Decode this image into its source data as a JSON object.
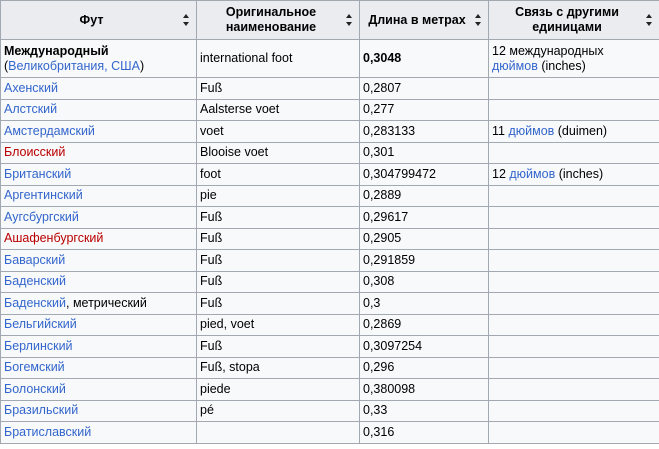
{
  "columns": [
    {
      "label": "Фут"
    },
    {
      "label": "Оригинальное наименование"
    },
    {
      "label": "Длина в метрах"
    },
    {
      "label": "Связь с другими единицами"
    }
  ],
  "first_row": {
    "name": "Международный",
    "paren_open": "(",
    "country_link": "Великобритания, США",
    "paren_close": ")",
    "original": "international foot",
    "length": "0,3048",
    "relation_prefix": "12 международных",
    "relation_link": "дюймов",
    "relation_suffix": " (inches)"
  },
  "rows": [
    {
      "name": "Ахенский",
      "name_color": "blue",
      "extra": "",
      "original": "Fuß",
      "length": "0,2807",
      "rel_pre": "",
      "rel_link": "",
      "rel_suf": ""
    },
    {
      "name": "Алстский",
      "name_color": "blue",
      "extra": "",
      "original": "Aalsterse voet",
      "length": "0,277",
      "rel_pre": "",
      "rel_link": "",
      "rel_suf": ""
    },
    {
      "name": "Амстердамский",
      "name_color": "blue",
      "extra": "",
      "original": "voet",
      "length": "0,283133",
      "rel_pre": "11 ",
      "rel_link": "дюймов",
      "rel_suf": " (duimen)"
    },
    {
      "name": "Блоисский",
      "name_color": "red",
      "extra": "",
      "original": "Blooise voet",
      "length": "0,301",
      "rel_pre": "",
      "rel_link": "",
      "rel_suf": ""
    },
    {
      "name": "Британский",
      "name_color": "blue",
      "extra": "",
      "original": "foot",
      "length": "0,304799472",
      "rel_pre": "12 ",
      "rel_link": "дюймов",
      "rel_suf": " (inches)"
    },
    {
      "name": "Аргентинский",
      "name_color": "blue",
      "extra": "",
      "original": "pie",
      "length": "0,2889",
      "rel_pre": "",
      "rel_link": "",
      "rel_suf": ""
    },
    {
      "name": "Аугсбургский",
      "name_color": "blue",
      "extra": "",
      "original": "Fuß",
      "length": "0,29617",
      "rel_pre": "",
      "rel_link": "",
      "rel_suf": ""
    },
    {
      "name": "Ашафенбургский",
      "name_color": "red",
      "extra": "",
      "original": "Fuß",
      "length": "0,2905",
      "rel_pre": "",
      "rel_link": "",
      "rel_suf": ""
    },
    {
      "name": "Баварский",
      "name_color": "blue",
      "extra": "",
      "original": "Fuß",
      "length": "0,291859",
      "rel_pre": "",
      "rel_link": "",
      "rel_suf": ""
    },
    {
      "name": "Баденский",
      "name_color": "blue",
      "extra": "",
      "original": "Fuß",
      "length": "0,308",
      "rel_pre": "",
      "rel_link": "",
      "rel_suf": ""
    },
    {
      "name": "Баденский",
      "name_color": "blue",
      "extra": ", метрический",
      "original": "Fuß",
      "length": "0,3",
      "rel_pre": "",
      "rel_link": "",
      "rel_suf": ""
    },
    {
      "name": "Бельгийский",
      "name_color": "blue",
      "extra": "",
      "original": "pied, voet",
      "length": "0,2869",
      "rel_pre": "",
      "rel_link": "",
      "rel_suf": ""
    },
    {
      "name": "Берлинский",
      "name_color": "blue",
      "extra": "",
      "original": "Fuß",
      "length": "0,3097254",
      "rel_pre": "",
      "rel_link": "",
      "rel_suf": ""
    },
    {
      "name": "Богемский",
      "name_color": "blue",
      "extra": "",
      "original": "Fuß, stopa",
      "length": "0,296",
      "rel_pre": "",
      "rel_link": "",
      "rel_suf": ""
    },
    {
      "name": "Болонский",
      "name_color": "blue",
      "extra": "",
      "original": "piede",
      "length": "0,380098",
      "rel_pre": "",
      "rel_link": "",
      "rel_suf": ""
    },
    {
      "name": "Бразильский",
      "name_color": "blue",
      "extra": "",
      "original": "pé",
      "length": "0,33",
      "rel_pre": "",
      "rel_link": "",
      "rel_suf": ""
    },
    {
      "name": "Братиславский",
      "name_color": "blue",
      "extra": "",
      "original": "",
      "length": "0,316",
      "rel_pre": "",
      "rel_link": "",
      "rel_suf": ""
    }
  ],
  "colors": {
    "link": "#3366cc",
    "new_link": "#ba0000",
    "header_bg": "#eaecf0",
    "cell_bg": "#f8f9fa",
    "border": "#a2a9b1"
  },
  "icons": {
    "sort": "sort-arrows-icon"
  }
}
